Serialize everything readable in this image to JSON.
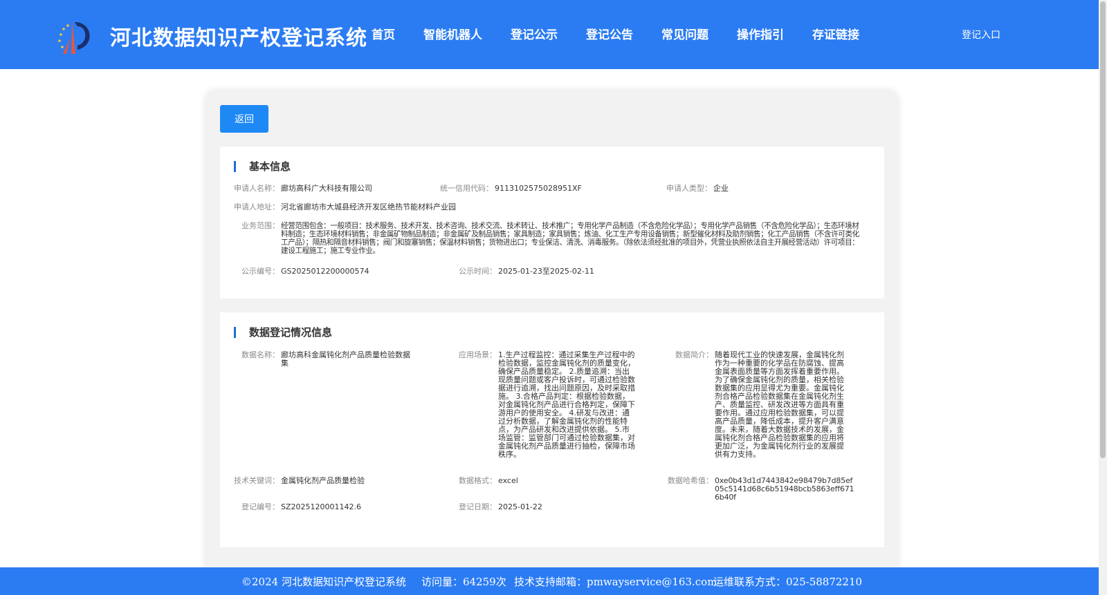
{
  "header": {
    "title": "河北数据知识产权登记系统",
    "nav": [
      "首页",
      "智能机器人",
      "登记公示",
      "登记公告",
      "常见问题",
      "操作指引",
      "存证链接"
    ],
    "login": "登记入口"
  },
  "back_label": "返回",
  "basic": {
    "title": "基本信息",
    "applicant_name_label": "申请人名称：",
    "applicant_name": "廊坊高科广大科技有限公司",
    "credit_code_label": "统一信用代码：",
    "credit_code": "9113102575028951XF",
    "applicant_type_label": "申请人类型：",
    "applicant_type": "企业",
    "address_label": "申请人地址：",
    "address": "河北省廊坊市大城县经济开发区绝热节能材料产业园",
    "scope_label": "业务范围：",
    "scope": "经营范围包含：一般项目：技术服务、技术开发、技术咨询、技术交流、技术转让、技术推广；专用化学产品制造（不含危险化学品）；专用化学产品销售（不含危险化学品）；生态环境材料制造；生态环境材料销售；非金属矿物制品制造；非金属矿及制品销售；家具制造；家具销售；炼油、化工生产专用设备销售；新型催化材料及助剂销售；化工产品销售（不含许可类化工产品）；隔热和隔音材料销售；阀门和旋塞销售；保温材料销售；货物进出口；专业保洁、清洗、消毒服务。（除依法须经批准的项目外，凭营业执照依法自主开展经营活动）许可项目：建设工程施工；施工专业作业。",
    "pub_no_label": "公示编号：",
    "pub_no": "GS2025012200000574",
    "pub_time_label": "公示时间：",
    "pub_time": "2025-01-23至2025-02-11"
  },
  "data_reg": {
    "title": "数据登记情况信息",
    "name_label": "数据名称：",
    "name": "廊坊高科金属钝化剂产品质量检验数据集",
    "scene_label": "应用场景：",
    "scene": "1.生产过程监控：通过采集生产过程中的检验数据，监控金属钝化剂的质量变化，确保产品质量稳定。 2.质量追溯：当出现质量问题或客户投诉时，可通过检验数据进行追溯，找出问题原因，及时采取措施。 3.合格产品判定：根据检验数据，对金属钝化剂产品进行合格判定，保障下游用户的使用安全。 4.研发与改进：通过分析数据，了解金属钝化剂的性能特点，为产品研发和改进提供依据。 5.市场监管：监管部门可通过检验数据集，对金属钝化剂产品质量进行抽检，保障市场秩序。",
    "intro_label": "数据简介：",
    "intro": "随着现代工业的快速发展，金属钝化剂作为一种重要的化学品在防腐蚀、提高金属表面质量等方面发挥着重要作用。为了确保金属钝化剂的质量，相关检验数据集的应用显得尤为重要。金属钝化剂合格产品检验数据集在金属钝化剂生产、质量监控、研发改进等方面具有重要作用。通过应用检验数据集，可以提高产品质量，降低成本，提升客户满意度。未来，随着大数据技术的发展，金属钝化剂合格产品检验数据集的应用将更加广泛，为金属钝化剂行业的发展提供有力支持。",
    "keyword_label": "技术关键词：",
    "keyword": "金属钝化剂产品质量检验",
    "format_label": "数据格式：",
    "format": "excel",
    "hash_label": "数据哈希值：",
    "hash": "0xe0b43d1d7443842e98479b7d85ef05c5141d68c6b51948bcb5863eff6716b40f",
    "reg_no_label": "登记编号：",
    "reg_no": "SZ2025120001142.6",
    "reg_date_label": "登记日期：",
    "reg_date": "2025-01-22"
  },
  "footer": {
    "copyright": "©2024 河北数据知识产权登记系统",
    "visits": "访问量：64259次",
    "email": "技术支持邮箱：pmwayservice@163.com",
    "phone": "运维联系方式：025-58872210"
  },
  "colors": {
    "brand": "#2b7cf3",
    "button": "#1e88f5",
    "accent_bar": "#1e6cd9"
  }
}
